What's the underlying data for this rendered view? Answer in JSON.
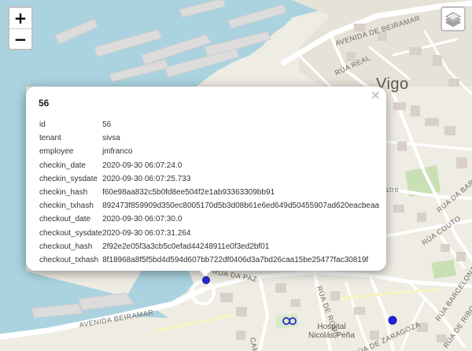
{
  "map": {
    "labels": {
      "city": "Vigo",
      "avenida_beiramar_top": "AVENIDA DE BEIRAMAR",
      "rua_real": "RÚA REAL",
      "rua_da_paz": "RÚA DA PAZ",
      "avenida_beiramar_bottom": "AVENIDA BEIRAMAR",
      "rua_de_romil": "RÚA DE ROMIL",
      "rua_barcelona": "RÚA BARCELONA",
      "rua_zaragoza": "RÚA DE ZARAGOZA",
      "rua_couto": "RÚA COUTO",
      "rua_da_barxa": "RÚA DA BARXA",
      "rua_de_ribo": "RÚA DE RIBO",
      "hospital": "Hospital\nNicolás Peña",
      "camino": "CAMIÑ",
      "stro": "stro"
    },
    "colors": {
      "water": "#aad3df",
      "land": "#eeece3",
      "marker": "#2222dd"
    }
  },
  "controls": {
    "zoom_in": "+",
    "zoom_out": "−",
    "layers_icon": "layers-icon"
  },
  "popup": {
    "title": "56",
    "close": "×",
    "rows": [
      {
        "key": "id",
        "value": "56"
      },
      {
        "key": "tenant",
        "value": "sivsa"
      },
      {
        "key": "employee",
        "value": "jmfranco"
      },
      {
        "key": "checkin_date",
        "value": "2020-09-30 06:07:24.0"
      },
      {
        "key": "checkin_sysdate",
        "value": "2020-09-30 06:07:25.733"
      },
      {
        "key": "checkin_hash",
        "value": "f60e98aa832c5b0fd8ee504f2e1ab93363309bb91"
      },
      {
        "key": "checkin_txhash",
        "value": "892473f859909d350ec8005170d5b3d08b61e6ed649d50455907ad620eacbeaa"
      },
      {
        "key": "checkout_date",
        "value": "2020-09-30 06:07:30.0"
      },
      {
        "key": "checkout_sysdate",
        "value": "2020-09-30 06:07:31.264"
      },
      {
        "key": "checkout_hash",
        "value": "2f92e2e05f3a3cb5c0efad44248911e0f3ed2bf01"
      },
      {
        "key": "checkout_txhash",
        "value": "8f18968a8f5f5bd4d594d607bb722df0406d3a7bd26caa15be25477fac30819f"
      }
    ]
  }
}
